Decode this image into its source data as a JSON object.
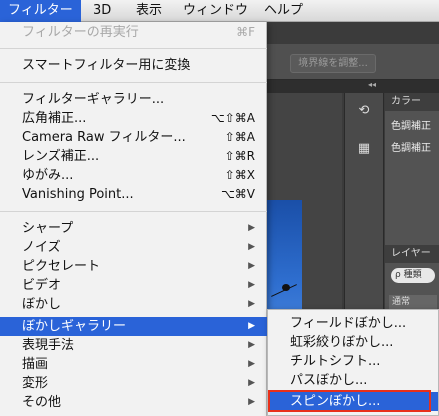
{
  "menubar": {
    "items": [
      {
        "label": "フィルター"
      },
      {
        "label": "3D"
      },
      {
        "label": "表示"
      },
      {
        "label": "ウィンドウ"
      },
      {
        "label": "ヘルプ"
      }
    ]
  },
  "background": {
    "refine_edge_button": "境界線を調整...",
    "collapse_arrows": "◂◂",
    "panel_tabs": {
      "color": "カラー",
      "layers": "レイヤー"
    },
    "adjustment_rows": [
      "色調補正",
      "色調補正"
    ],
    "layer_search": "ρ 種類",
    "blend_mode": "通常"
  },
  "filter_menu": {
    "items": [
      {
        "label": "フィルターの再実行",
        "shortcut": "⌘F"
      },
      {
        "label": "スマートフィルター用に変換"
      },
      {
        "label": "フィルターギャラリー..."
      },
      {
        "label": "広角補正...",
        "shortcut": "⌥⇧⌘A"
      },
      {
        "label": "Camera Raw フィルター...",
        "shortcut": "⇧⌘A"
      },
      {
        "label": "レンズ補正...",
        "shortcut": "⇧⌘R"
      },
      {
        "label": "ゆがみ...",
        "shortcut": "⇧⌘X"
      },
      {
        "label": "Vanishing Point...",
        "shortcut": "⌥⌘V"
      },
      {
        "label": "シャープ",
        "arrow": "▶"
      },
      {
        "label": "ノイズ",
        "arrow": "▶"
      },
      {
        "label": "ピクセレート",
        "arrow": "▶"
      },
      {
        "label": "ビデオ",
        "arrow": "▶"
      },
      {
        "label": "ぼかし",
        "arrow": "▶"
      },
      {
        "label": "ぼかしギャラリー",
        "arrow": "▶"
      },
      {
        "label": "表現手法",
        "arrow": "▶"
      },
      {
        "label": "描画",
        "arrow": "▶"
      },
      {
        "label": "変形",
        "arrow": "▶"
      },
      {
        "label": "その他",
        "arrow": "▶"
      }
    ]
  },
  "blur_gallery_submenu": {
    "items": [
      {
        "label": "フィールドぼかし..."
      },
      {
        "label": "虹彩絞りぼかし..."
      },
      {
        "label": "チルトシフト..."
      },
      {
        "label": "パスぼかし..."
      },
      {
        "label": "スピンぼかし..."
      }
    ]
  },
  "colors": {
    "highlight": "#2a63d8",
    "callout": "#e8301a"
  }
}
